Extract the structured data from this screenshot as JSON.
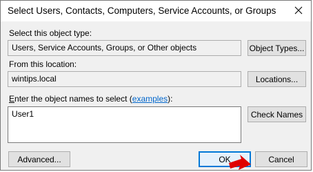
{
  "dialog": {
    "title": "Select Users, Contacts, Computers, Service Accounts, or Groups",
    "close_icon": "close-icon"
  },
  "object_type": {
    "label": "Select this object type:",
    "value": "Users, Service Accounts, Groups, or Other objects",
    "button": "Object Types..."
  },
  "location": {
    "label": "From this location:",
    "value": "wintips.local",
    "button": "Locations..."
  },
  "names": {
    "label_prefix": "nter the object names to select (",
    "label_first_char": "E",
    "label_link": "examples",
    "label_suffix": "):",
    "value": "User1",
    "button": "Check Names"
  },
  "footer": {
    "advanced": "Advanced...",
    "ok": "OK",
    "cancel": "Cancel"
  },
  "annotation": {
    "arrow_color": "#e00000",
    "arrow_icon": "red-arrow-icon"
  }
}
